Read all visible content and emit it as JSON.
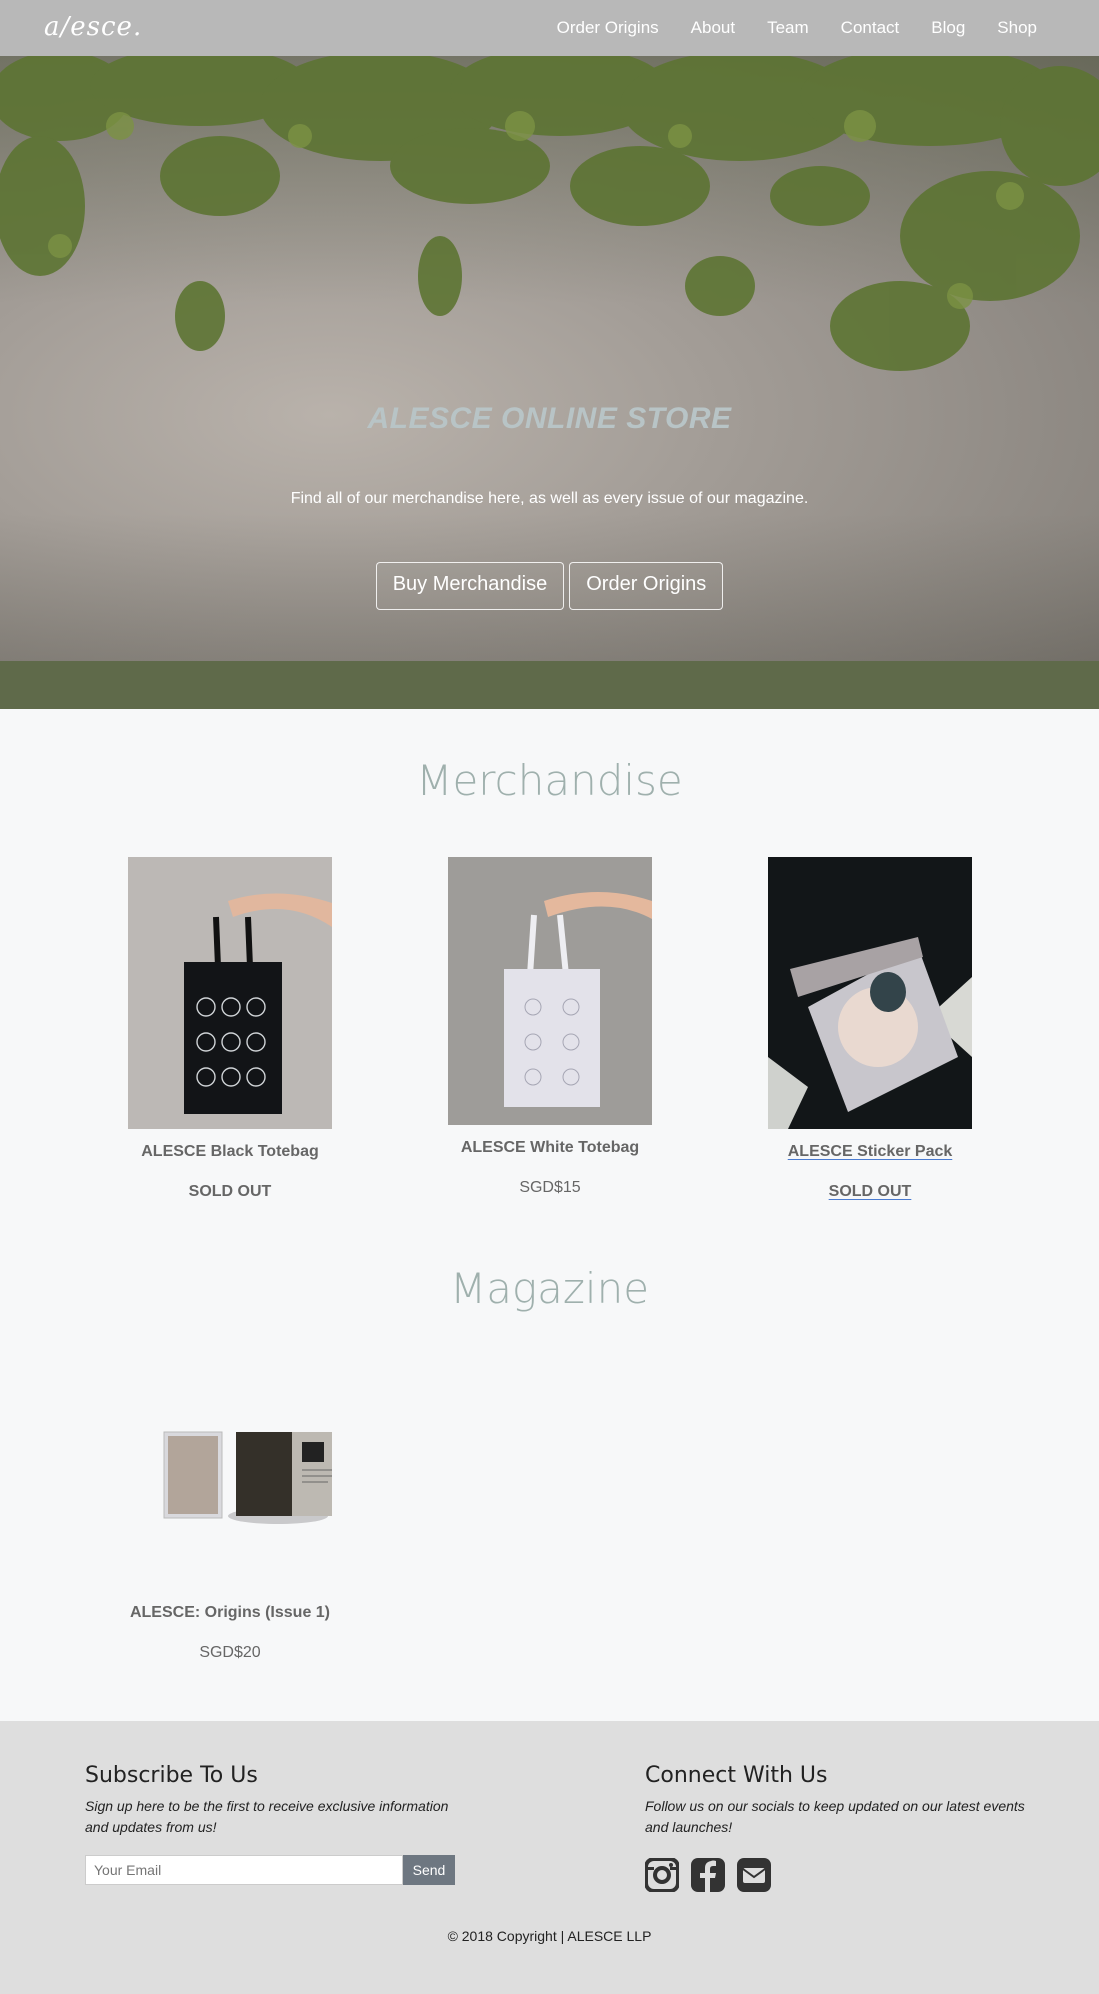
{
  "nav": {
    "logo": "a/esce.",
    "links": [
      "Order Origins",
      "About",
      "Team",
      "Contact",
      "Blog",
      "Shop"
    ]
  },
  "hero": {
    "title": "ALESCE ONLINE STORE",
    "subtitle": "Find all of our merchandise here, as well as every issue of our magazine.",
    "buttons": [
      "Buy Merchandise",
      "Order Origins"
    ]
  },
  "merchandise": {
    "title": "Merchandise",
    "products": [
      {
        "name": "ALESCE Black Totebag",
        "price": "SOLD OUT"
      },
      {
        "name": "ALESCE White Totebag",
        "price": "SGD$15"
      },
      {
        "name": "ALESCE Sticker Pack",
        "price": "SOLD OUT"
      }
    ]
  },
  "magazine": {
    "title": "Magazine",
    "products": [
      {
        "name": "ALESCE: Origins (Issue 1)",
        "price": "SGD$20"
      }
    ]
  },
  "footer": {
    "subscribe": {
      "title": "Subscribe To Us",
      "text": "Sign up here to be the first to receive exclusive information and updates from us!",
      "placeholder": "Your Email",
      "button": "Send"
    },
    "connect": {
      "title": "Connect With Us",
      "text": "Follow us on our socials to keep updated on our latest events and launches!",
      "icons": [
        "instagram-icon",
        "facebook-icon",
        "email-icon"
      ]
    },
    "copyright": "© 2018 Copyright | ALESCE LLP"
  }
}
